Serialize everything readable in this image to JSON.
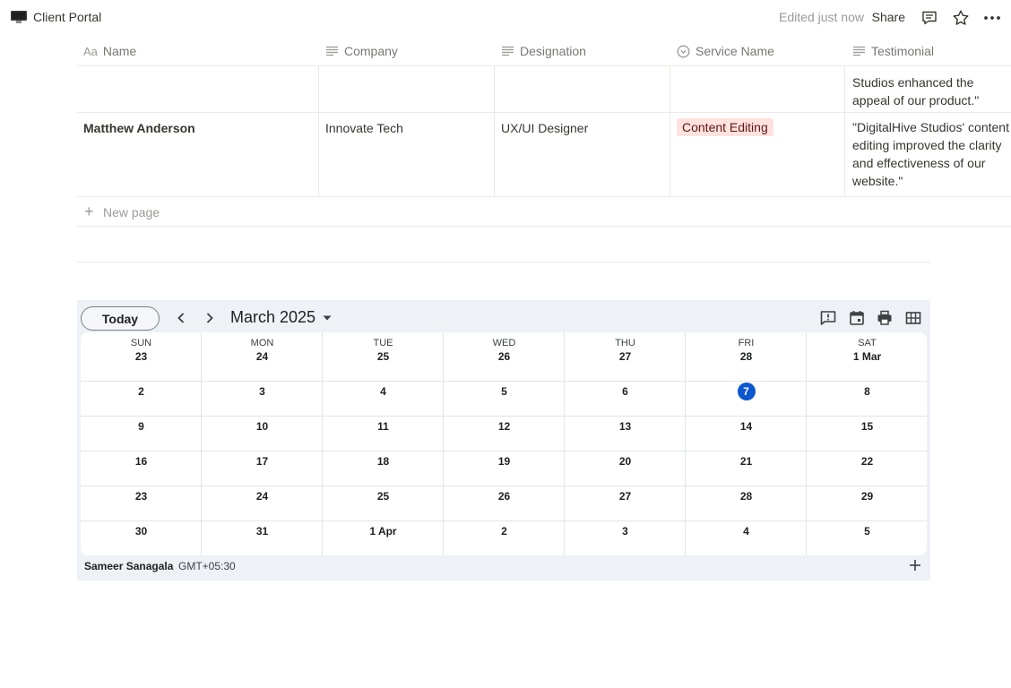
{
  "topbar": {
    "title": "Client Portal",
    "edited": "Edited just now",
    "share": "Share",
    "icons": [
      "comment-icon",
      "star-icon",
      "more-icon"
    ]
  },
  "table": {
    "columns": [
      {
        "label": "Name",
        "icon": "text-title-icon"
      },
      {
        "label": "Company",
        "icon": "text-lines-icon"
      },
      {
        "label": "Designation",
        "icon": "text-lines-icon"
      },
      {
        "label": "Service Name",
        "icon": "select-icon"
      },
      {
        "label": "Testimonial",
        "icon": "text-lines-icon"
      }
    ],
    "partial_row": {
      "testimonial": "Studios enhanced the appeal of our product.\""
    },
    "rows": [
      {
        "name": "Matthew Anderson",
        "company": "Innovate Tech",
        "designation": "UX/UI Designer",
        "service": "Content Editing",
        "service_color": "#ffe2dd",
        "testimonial": "\"DigitalHive Studios' content editing improved the clarity and effectiveness of our website.\""
      }
    ],
    "new_page": "New page"
  },
  "calendar": {
    "today_label": "Today",
    "month": "March 2025",
    "weekdays": [
      "SUN",
      "MON",
      "TUE",
      "WED",
      "THU",
      "FRI",
      "SAT"
    ],
    "weeks": [
      [
        "23",
        "24",
        "25",
        "26",
        "27",
        "28",
        "1 Mar"
      ],
      [
        "2",
        "3",
        "4",
        "5",
        "6",
        "7",
        "8"
      ],
      [
        "9",
        "10",
        "11",
        "12",
        "13",
        "14",
        "15"
      ],
      [
        "16",
        "17",
        "18",
        "19",
        "20",
        "21",
        "22"
      ],
      [
        "23",
        "24",
        "25",
        "26",
        "27",
        "28",
        "29"
      ],
      [
        "30",
        "31",
        "1 Apr",
        "2",
        "3",
        "4",
        "5"
      ]
    ],
    "today": "7",
    "accent": "#0b57d0",
    "owner": "Sameer Sanagala",
    "timezone": "GMT+05:30"
  }
}
